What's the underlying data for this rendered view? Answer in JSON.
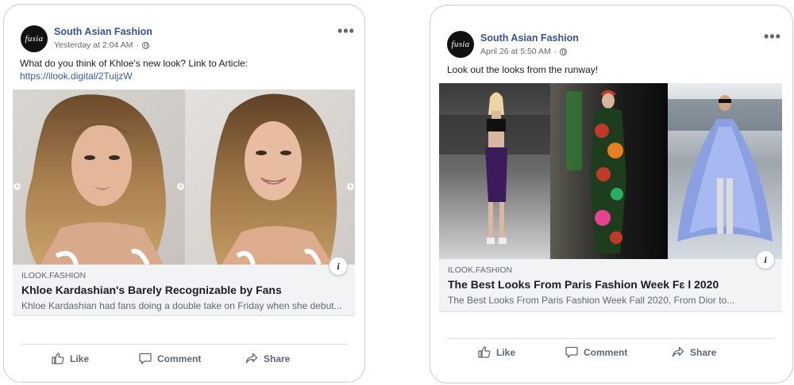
{
  "posts": [
    {
      "page_name": "South Asian Fashion",
      "avatar_text": "fusia",
      "timestamp": "Yesterday at 2:04 AM",
      "audience_icon": "globe-icon",
      "more_label": "•••",
      "text": "What do you think of Khloe's new look? Link to Article:",
      "link_text": "https://ilook.digital/2TuijzW",
      "link_preview": {
        "domain": "ILOOK.FASHION",
        "headline": "Khloe Kardashian's Barely Recognizable by Fans",
        "description": "Khloe Kardashian had fans doing a double take on Friday when she debut..."
      },
      "actions": [
        "Like",
        "Comment",
        "Share"
      ]
    },
    {
      "page_name": "South Asian Fashion",
      "avatar_text": "fusia",
      "timestamp": "April 26 at 5:50 AM",
      "audience_icon": "globe-icon",
      "more_label": "•••",
      "text": "Look out the looks from the runway!",
      "link_preview": {
        "domain": "ILOOK.FASHION",
        "headline": "The Best Looks From Paris Fashion Week Fɛ l 2020",
        "description": "The Best Looks From Paris Fashion Week Fall 2020, From Dior to..."
      },
      "actions": [
        "Like",
        "Comment",
        "Share"
      ]
    }
  ],
  "colors": {
    "page_name": "#3b5290",
    "link": "#3b5998",
    "muted": "#606770",
    "card_border": "#c9ccd1"
  }
}
